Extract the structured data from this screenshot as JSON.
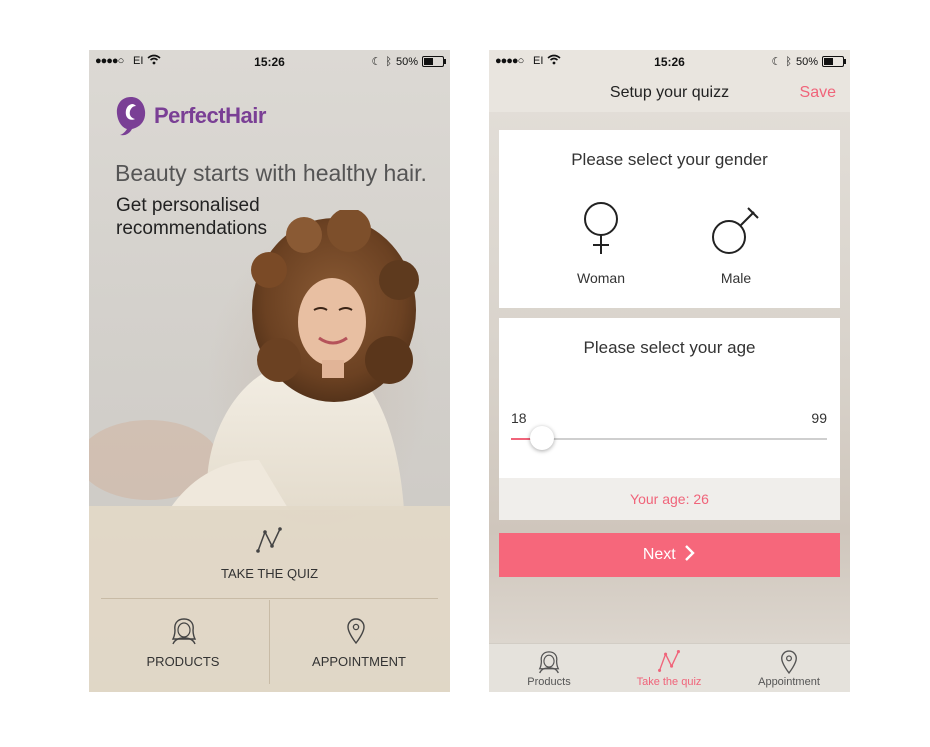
{
  "left_screen": {
    "status_bar": {
      "signal": "●●●●○",
      "carrier": "EI",
      "time": "15:26",
      "battery_percent": "50%"
    },
    "logo": {
      "text": "PerfectHair",
      "color": "#7a3f95"
    },
    "tagline": "Beauty starts with healthy hair.",
    "subtitle": "Get personalised recommendations",
    "quiz_button": {
      "icon": "quiz-line-icon",
      "label": "TAKE THE QUIZ"
    },
    "products_button": {
      "icon": "woman-face-icon",
      "label": "PRODUCTS"
    },
    "appointment_button": {
      "icon": "location-pin-icon",
      "label": "APPOINTMENT"
    }
  },
  "right_screen": {
    "status_bar": {
      "signal": "●●●●○",
      "carrier": "EI",
      "time": "15:26",
      "battery_percent": "50%"
    },
    "navbar": {
      "title": "Setup your quizz",
      "save_label": "Save",
      "accent": "#f0647a"
    },
    "gender_card": {
      "title": "Please select your gender",
      "options": [
        {
          "label": "Woman",
          "icon": "female-symbol-icon"
        },
        {
          "label": "Male",
          "icon": "male-symbol-icon"
        }
      ]
    },
    "age_card": {
      "title": "Please select your age",
      "min": 18,
      "max": 99,
      "min_label": "18",
      "max_label": "99",
      "value": 26,
      "result_label": "Your age: 26"
    },
    "next_button": {
      "label": "Next",
      "color": "#f6677b"
    },
    "tab_bar": {
      "tabs": [
        {
          "label": "Products",
          "icon": "woman-face-icon",
          "active": false
        },
        {
          "label": "Take the quiz",
          "icon": "quiz-line-icon",
          "active": true
        },
        {
          "label": "Appointment",
          "icon": "location-pin-icon",
          "active": false
        }
      ]
    }
  }
}
